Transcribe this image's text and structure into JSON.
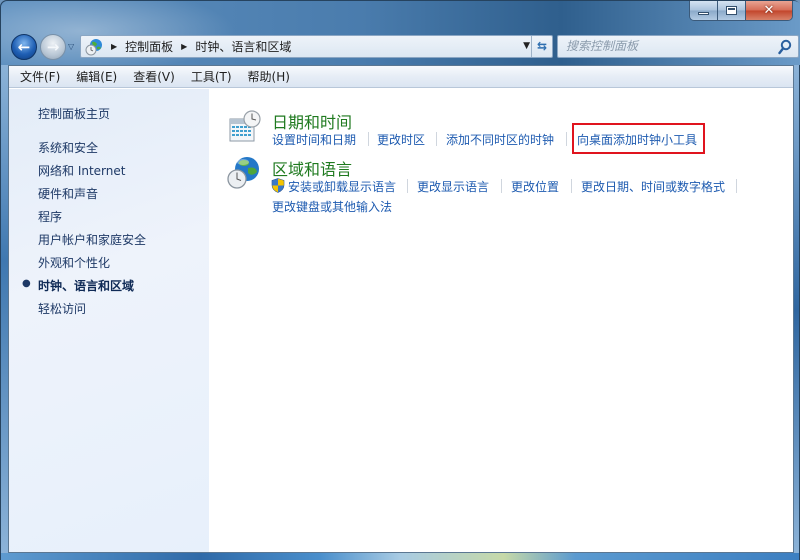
{
  "window": {
    "caption_buttons": {
      "minimize": "minimize",
      "maximize": "maximize",
      "close": "✕"
    }
  },
  "navigation": {
    "back_icon": "arrow-left-icon",
    "forward_icon": "arrow-right-icon",
    "breadcrumb": [
      "控制面板",
      "时钟、语言和区域"
    ],
    "search_placeholder": "搜索控制面板"
  },
  "menubar": {
    "items": [
      "文件(F)",
      "编辑(E)",
      "查看(V)",
      "工具(T)",
      "帮助(H)"
    ]
  },
  "sidebar": {
    "home": "控制面板主页",
    "items": [
      {
        "label": "系统和安全",
        "current": false
      },
      {
        "label": "网络和 Internet",
        "current": false
      },
      {
        "label": "硬件和声音",
        "current": false
      },
      {
        "label": "程序",
        "current": false
      },
      {
        "label": "用户帐户和家庭安全",
        "current": false
      },
      {
        "label": "外观和个性化",
        "current": false
      },
      {
        "label": "时钟、语言和区域",
        "current": true
      },
      {
        "label": "轻松访问",
        "current": false
      }
    ]
  },
  "main": {
    "categories": [
      {
        "title": "日期和时间",
        "icon": "calendar-clock-icon",
        "links": [
          "设置时间和日期",
          "更改时区",
          "添加不同时区的时钟",
          "向桌面添加时钟小工具"
        ],
        "highlighted_link": "向桌面添加时钟小工具"
      },
      {
        "title": "区域和语言",
        "icon": "globe-clock-icon",
        "links": [
          "安装或卸载显示语言",
          "更改显示语言",
          "更改位置",
          "更改日期、时间或数字格式",
          "更改键盘或其他输入法"
        ],
        "shield_link": "安装或卸载显示语言"
      }
    ]
  },
  "colors": {
    "link": "#1e5bb0",
    "category_title": "#1f7a1f",
    "highlight_box": "#e0141e",
    "sidebar_text": "#1e3966"
  }
}
